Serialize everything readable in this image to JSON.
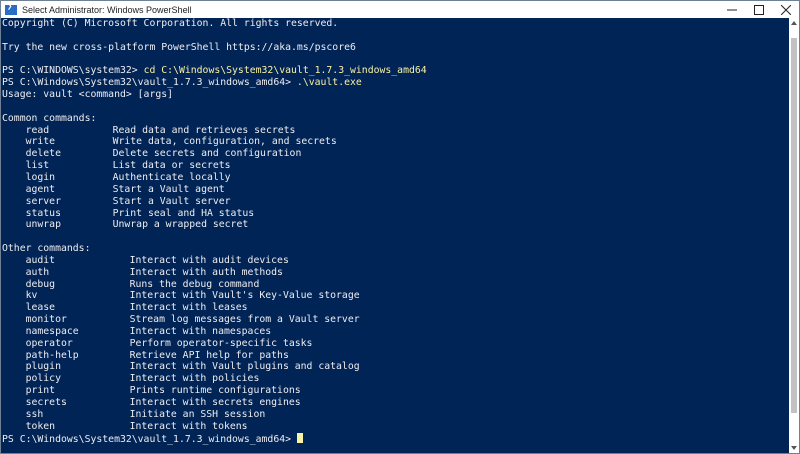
{
  "window": {
    "title": "Select Administrator: Windows PowerShell",
    "icon_glyph": "❯",
    "accent": "#012456",
    "text_color": "#eeedf0",
    "highlight_color": "#f9f1a5"
  },
  "terminal": {
    "copyright": "Copyright (C) Microsoft Corporation. All rights reserved.",
    "try_line": "Try the new cross-platform PowerShell https://aka.ms/pscore6",
    "prompt1": "PS C:\\WINDOWS\\system32> ",
    "cmd1": "cd C:\\Windows\\System32\\vault_1.7.3_windows_amd64",
    "prompt2": "PS C:\\Windows\\System32\\vault_1.7.3_windows_amd64> ",
    "cmd2": ".\\vault.exe",
    "usage": "Usage: vault <command> [args]",
    "common_header": "Common commands:",
    "common_commands": [
      {
        "name": "read",
        "desc": "Read data and retrieves secrets"
      },
      {
        "name": "write",
        "desc": "Write data, configuration, and secrets"
      },
      {
        "name": "delete",
        "desc": "Delete secrets and configuration"
      },
      {
        "name": "list",
        "desc": "List data or secrets"
      },
      {
        "name": "login",
        "desc": "Authenticate locally"
      },
      {
        "name": "agent",
        "desc": "Start a Vault agent"
      },
      {
        "name": "server",
        "desc": "Start a Vault server"
      },
      {
        "name": "status",
        "desc": "Print seal and HA status"
      },
      {
        "name": "unwrap",
        "desc": "Unwrap a wrapped secret"
      }
    ],
    "other_header": "Other commands:",
    "other_commands": [
      {
        "name": "audit",
        "desc": "Interact with audit devices"
      },
      {
        "name": "auth",
        "desc": "Interact with auth methods"
      },
      {
        "name": "debug",
        "desc": "Runs the debug command"
      },
      {
        "name": "kv",
        "desc": "Interact with Vault's Key-Value storage"
      },
      {
        "name": "lease",
        "desc": "Interact with leases"
      },
      {
        "name": "monitor",
        "desc": "Stream log messages from a Vault server"
      },
      {
        "name": "namespace",
        "desc": "Interact with namespaces"
      },
      {
        "name": "operator",
        "desc": "Perform operator-specific tasks"
      },
      {
        "name": "path-help",
        "desc": "Retrieve API help for paths"
      },
      {
        "name": "plugin",
        "desc": "Interact with Vault plugins and catalog"
      },
      {
        "name": "policy",
        "desc": "Interact with policies"
      },
      {
        "name": "print",
        "desc": "Prints runtime configurations"
      },
      {
        "name": "secrets",
        "desc": "Interact with secrets engines"
      },
      {
        "name": "ssh",
        "desc": "Initiate an SSH session"
      },
      {
        "name": "token",
        "desc": "Interact with tokens"
      }
    ],
    "final_prompt": "PS C:\\Windows\\System32\\vault_1.7.3_windows_amd64> "
  }
}
